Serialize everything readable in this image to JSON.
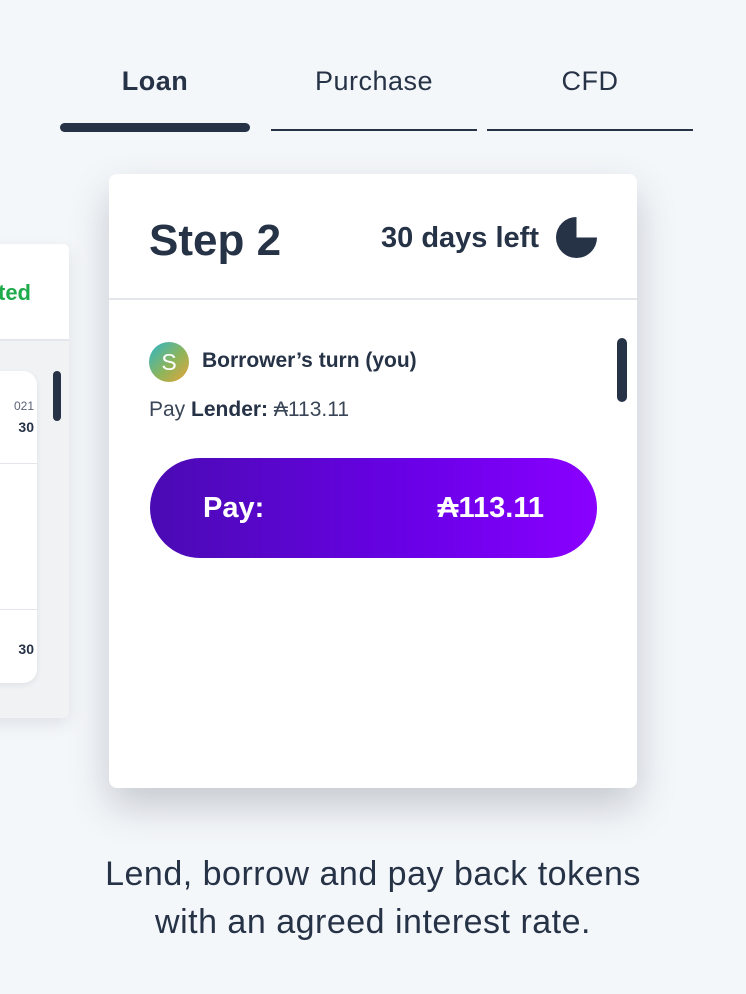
{
  "tabs": [
    {
      "label": "Loan",
      "active": true
    },
    {
      "label": "Purchase",
      "active": false
    },
    {
      "label": "CFD",
      "active": false
    }
  ],
  "background_card": {
    "status_text": "ted",
    "status_color": "#1faa4c",
    "date_fragment": "021",
    "value_top": "30",
    "value_bottom": "30"
  },
  "step_card": {
    "title": "Step 2",
    "days_left": "30 days left",
    "time_icon": "pie-clock-icon",
    "avatar_letter": "S",
    "turn_label": "Borrower’s turn (you)",
    "pay_prefix": "Pay",
    "pay_party": "Lender:",
    "pay_amount": "₳113.11",
    "button_label": "Pay:",
    "button_amount": "₳113.11"
  },
  "caption": {
    "line1": "Lend, borrow and pay back tokens",
    "line2": "with an agreed interest rate."
  },
  "colors": {
    "background": "#f4f7fa",
    "text_dark": "#263246",
    "button_gradient_start": "#4a0bb3",
    "button_gradient_end": "#8a00ff",
    "status_green": "#1faa4c"
  }
}
